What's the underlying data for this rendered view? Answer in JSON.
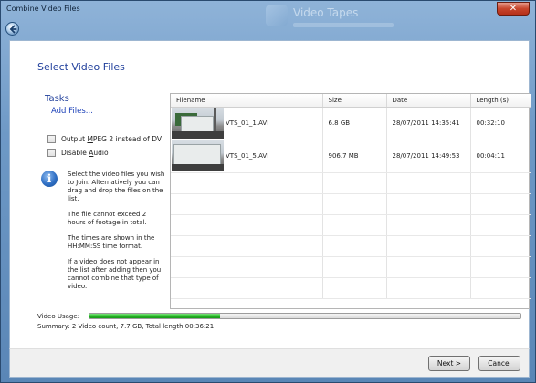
{
  "window": {
    "title": "Combine Video Files",
    "background_app_title": "Video Tapes",
    "close_glyph": "✕"
  },
  "page": {
    "heading": "Select Video Files"
  },
  "tasks": {
    "title": "Tasks",
    "add_files": "Add Files...",
    "options": [
      {
        "label_pre": "Output ",
        "label_key": "M",
        "label_post": "PEG 2 instead of DV",
        "checked": false
      },
      {
        "label_pre": "Disable ",
        "label_key": "A",
        "label_post": "udio",
        "checked": false
      }
    ]
  },
  "help": {
    "icon": "info-icon",
    "paragraphs": [
      "Select the video files you wish to Join.  Alternatively you can drag and drop the files on the list.",
      "The file cannot exceed 2 hours of footage in total.",
      "The times are shown in the HH:MM:SS time format.",
      "If a video does not appear in the list after adding then you cannot combine that type of video."
    ]
  },
  "table": {
    "columns": [
      "Filename",
      "Size",
      "Date",
      "Length (s)"
    ],
    "rows": [
      {
        "filename": "VTS_01_1.AVI",
        "size": "6.8 GB",
        "date": "28/07/2011 14:35:41",
        "length": "00:32:10"
      },
      {
        "filename": "VTS_01_5.AVI",
        "size": "906.7 MB",
        "date": "28/07/2011 14:49:53",
        "length": "00:04:11"
      }
    ]
  },
  "usage": {
    "label": "Video Usage:",
    "fraction": 0.302,
    "summary": "Summary: 2 Video count, 7.7 GB, Total length 00:36:21"
  },
  "buttons": {
    "next_key": "N",
    "next_rest": "ext >",
    "cancel": "Cancel"
  },
  "colors": {
    "heading_blue": "#1f3e9b",
    "link_blue": "#1a3fb8",
    "progress_green": "#26b826"
  }
}
